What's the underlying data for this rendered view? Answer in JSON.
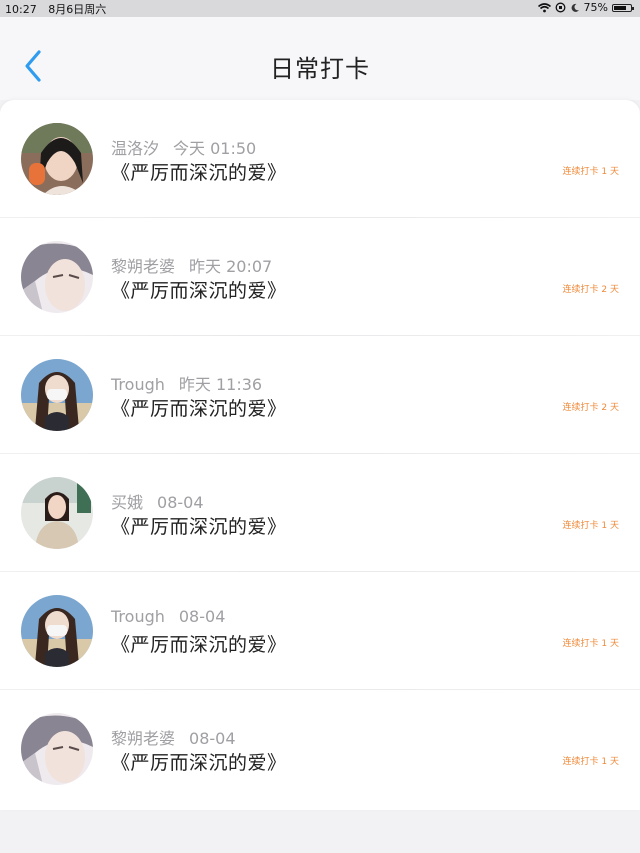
{
  "status_bar": {
    "time": "10:27",
    "date": "8月6日周六",
    "battery": "75%",
    "battery_level": 0.75
  },
  "header": {
    "title": "日常打卡"
  },
  "colors": {
    "accent": "#2f9cf0",
    "streak": "#f08a3a"
  },
  "feed": [
    {
      "name": "温洛汐",
      "time": "今天 01:50",
      "book": "《严厉而深沉的爱》",
      "streak": "连续打卡 1 天"
    },
    {
      "name": "黎朔老婆",
      "time": "昨天 20:07",
      "book": "《严厉而深沉的爱》",
      "streak": "连续打卡 2 天"
    },
    {
      "name": "Trough",
      "time": "昨天 11:36",
      "book": "《严厉而深沉的爱》",
      "streak": "连续打卡 2 天"
    },
    {
      "name": "买娥",
      "time": "08-04",
      "book": "《严厉而深沉的爱》",
      "streak": "连续打卡 1 天"
    },
    {
      "name": "Trough",
      "time": "08-04",
      "book": "《严厉而深沉的爱》",
      "streak": "连续打卡 1 天"
    },
    {
      "name": "黎朔老婆",
      "time": "08-04",
      "book": "《严厉而深沉的爱》",
      "streak": "连续打卡 1 天"
    }
  ]
}
